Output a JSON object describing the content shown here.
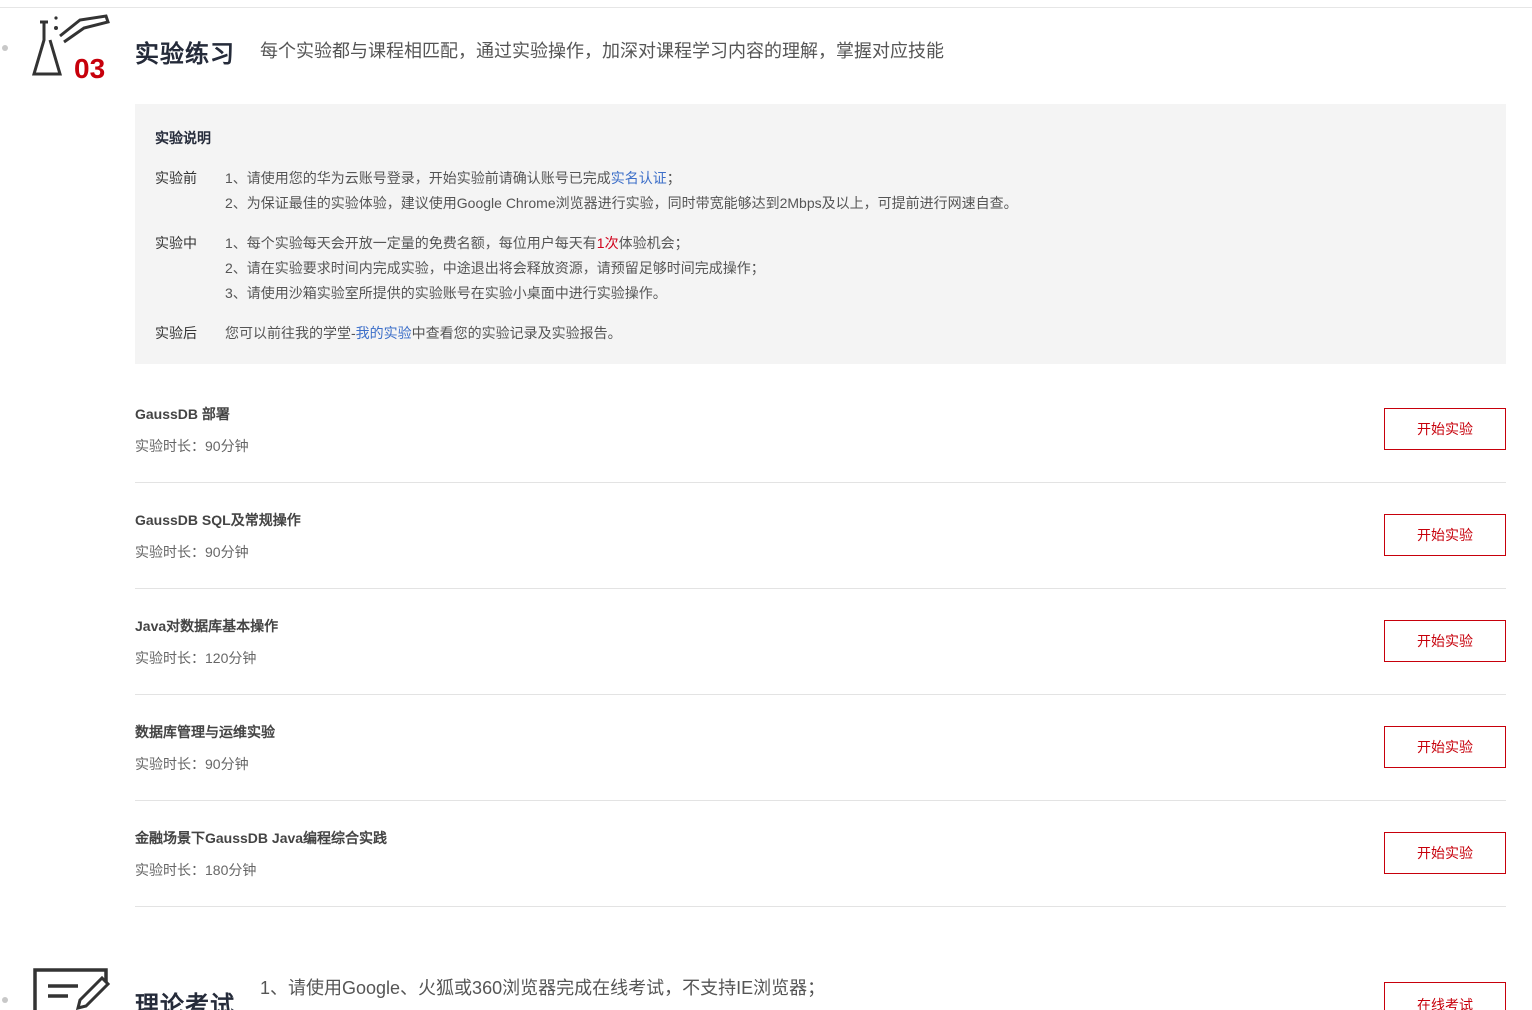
{
  "lab_section": {
    "number": "03",
    "title": "实验练习",
    "subtitle": "每个实验都与课程相匹配，通过实验操作，加深对课程学习内容的理解，掌握对应技能"
  },
  "notice": {
    "title": "实验说明",
    "before_label": "实验前",
    "before_1_pre": "1、请使用您的华为云账号登录，开始实验前请确认账号已完成",
    "before_1_link": "实名认证",
    "before_1_post": "；",
    "before_2": "2、为保证最佳的实验体验，建议使用Google Chrome浏览器进行实验，同时带宽能够达到2Mbps及以上，可提前进行网速自查。",
    "during_label": "实验中",
    "during_1_pre": "1、每个实验每天会开放一定量的免费名额，每位用户每天有",
    "during_1_highlight": "1次",
    "during_1_post": "体验机会；",
    "during_2": "2、请在实验要求时间内完成实验，中途退出将会释放资源，请预留足够时间完成操作；",
    "during_3": "3、请使用沙箱实验室所提供的实验账号在实验小桌面中进行实验操作。",
    "after_label": "实验后",
    "after_pre": "您可以前往我的学堂-",
    "after_link": "我的实验",
    "after_post": "中查看您的实验记录及实验报告。"
  },
  "labs": [
    {
      "title": "GaussDB 部署",
      "duration": "实验时长：90分钟",
      "button": "开始实验"
    },
    {
      "title": "GaussDB SQL及常规操作",
      "duration": "实验时长：90分钟",
      "button": "开始实验"
    },
    {
      "title": "Java对数据库基本操作",
      "duration": "实验时长：120分钟",
      "button": "开始实验"
    },
    {
      "title": "数据库管理与运维实验",
      "duration": "实验时长：90分钟",
      "button": "开始实验"
    },
    {
      "title": "金融场景下GaussDB Java编程综合实践",
      "duration": "实验时长：180分钟",
      "button": "开始实验"
    }
  ],
  "exam_section": {
    "title": "理论考试",
    "line_1": "1、请使用Google、火狐或360浏览器完成在线考试，不支持IE浏览器；",
    "button": "在线考试"
  },
  "colors": {
    "accent": "#c7000b",
    "link": "#3d6fc9",
    "notice_bg": "#f4f4f4"
  }
}
